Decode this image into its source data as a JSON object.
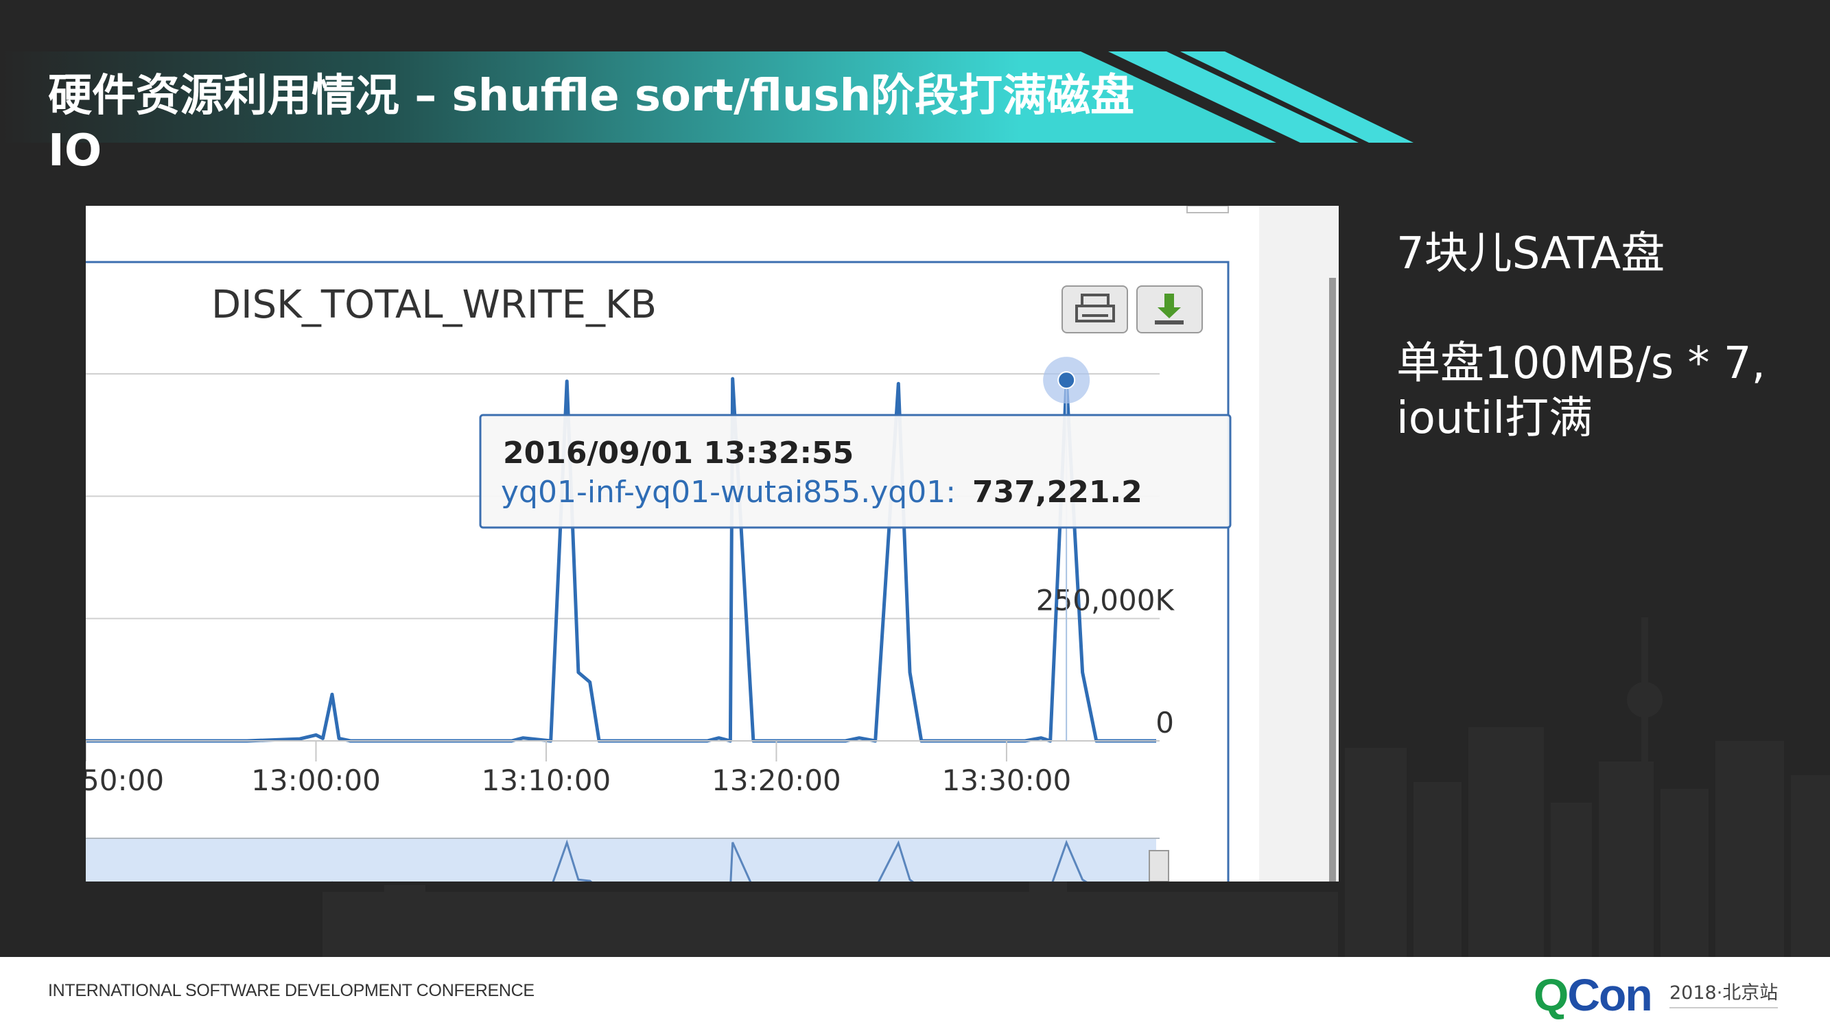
{
  "slide": {
    "title": "硬件资源利用情况 – shuffle sort/flush阶段打满磁盘IO",
    "notes": {
      "line1": "7块儿SATA盘",
      "line2": "单盘100MB/s * 7,",
      "line3": "ioutil打满"
    },
    "colors": {
      "background": "#262626",
      "accent_teal": "#3fd3d3",
      "chart_line": "#2f6db5",
      "navigator_fill": "#d6e4f7"
    }
  },
  "chart_card": {
    "toolbar": {
      "print_icon": "printer-icon",
      "download_icon": "download-icon"
    },
    "tooltip": {
      "timestamp": "2016/09/01 13:32:55",
      "series_name": "yq01-inf-yq01-wutai855.yq01:",
      "value": "737,221.2"
    }
  },
  "chart_data": {
    "type": "line",
    "title": "DISK_TOTAL_WRITE_KB",
    "xlabel": "",
    "ylabel": "",
    "x_tick_labels": [
      "50:00",
      "13:00:00",
      "13:10:00",
      "13:20:00",
      "13:30:00"
    ],
    "y_tick_labels": [
      "250,000K",
      "0"
    ],
    "x_range_minutes": [
      -10.0,
      36.5
    ],
    "ylim": [
      0,
      750000
    ],
    "grid": true,
    "legend": "none",
    "series": [
      {
        "name": "yq01-inf-yq01-wutai855.yq01",
        "points": [
          [
            -10,
            0
          ],
          [
            -3,
            0
          ],
          [
            -0.7,
            4000
          ],
          [
            0,
            12000
          ],
          [
            0.3,
            5000
          ],
          [
            0.7,
            95000
          ],
          [
            1,
            5000
          ],
          [
            1.5,
            0
          ],
          [
            8.5,
            0
          ],
          [
            9,
            6000
          ],
          [
            10.2,
            0
          ],
          [
            10.9,
            735000
          ],
          [
            11.4,
            140000
          ],
          [
            11.9,
            120000
          ],
          [
            12.3,
            0
          ],
          [
            17,
            0
          ],
          [
            17.5,
            6000
          ],
          [
            18,
            0
          ],
          [
            18.1,
            740000
          ],
          [
            19,
            0
          ],
          [
            23,
            0
          ],
          [
            23.6,
            6000
          ],
          [
            24.3,
            0
          ],
          [
            25.3,
            730000
          ],
          [
            25.8,
            140000
          ],
          [
            26.3,
            0
          ],
          [
            30.8,
            0
          ],
          [
            31.5,
            6000
          ],
          [
            31.9,
            0
          ],
          [
            32.6,
            737221.2
          ],
          [
            33.3,
            140000
          ],
          [
            33.9,
            0
          ],
          [
            36.5,
            0
          ]
        ]
      }
    ]
  },
  "footer": {
    "conference": "INTERNATIONAL SOFTWARE DEVELOPMENT CONFERENCE",
    "logo_q": "Q",
    "logo_rest": "Con",
    "edition": "2018·北京站"
  }
}
